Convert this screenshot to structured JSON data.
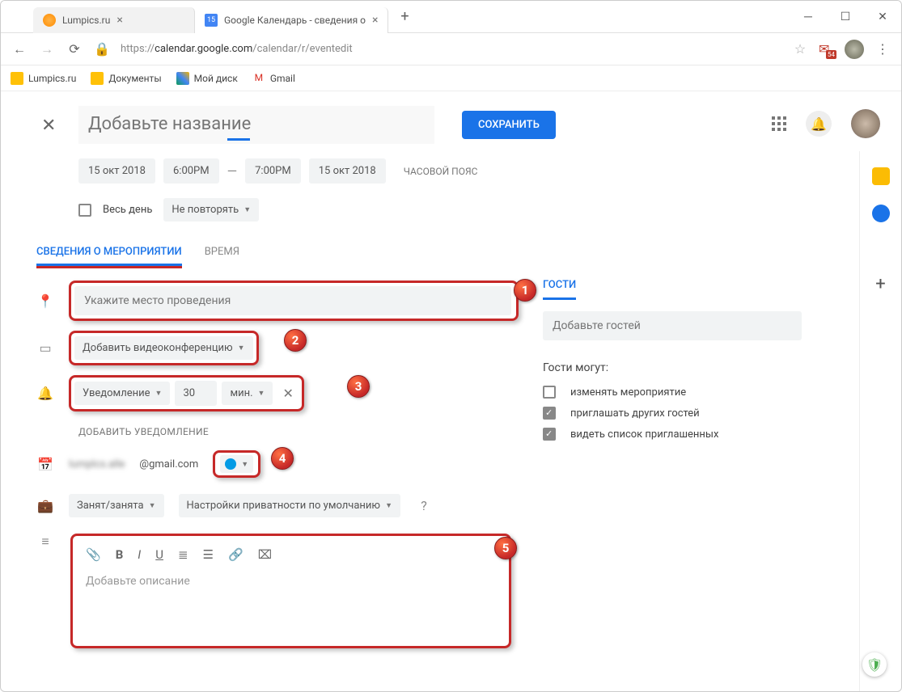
{
  "browser": {
    "tabs": [
      {
        "label": "Lumpics.ru"
      },
      {
        "label": "Google Календарь - сведения о",
        "badge": "15"
      }
    ],
    "url_prefix": "https://",
    "url_host": "calendar.google.com",
    "url_path": "/calendar/r/eventedit",
    "gmail_badge": "54",
    "bookmarks": [
      {
        "label": "Lumpics.ru"
      },
      {
        "label": "Документы"
      },
      {
        "label": "Мой диск"
      },
      {
        "label": "Gmail"
      }
    ]
  },
  "event": {
    "title_placeholder": "Добавьте название",
    "save_label": "СОХРАНИТЬ",
    "date_start": "15 окт 2018",
    "time_start": "6:00PM",
    "time_end": "7:00PM",
    "date_end": "15 окт 2018",
    "timezone_label": "ЧАСОВОЙ ПОЯС",
    "all_day_label": "Весь день",
    "repeat_label": "Не повторять",
    "tabs": {
      "details": "СВЕДЕНИЯ О МЕРОПРИЯТИИ",
      "time": "ВРЕМЯ"
    },
    "location_placeholder": "Укажите место проведения",
    "video_label": "Добавить видеоконференцию",
    "notification": {
      "type": "Уведомление",
      "value": "30",
      "unit": "мин."
    },
    "add_notification_label": "ДОБАВИТЬ УВЕДОМЛЕНИЕ",
    "organizer_email_suffix": "@gmail.com",
    "busy_label": "Занят/занята",
    "privacy_label": "Настройки приватности по умолчанию",
    "description_placeholder": "Добавьте описание"
  },
  "guests": {
    "tab_label": "ГОСТИ",
    "input_placeholder": "Добавьте гостей",
    "perms_title": "Гости могут:",
    "perm_modify": "изменять мероприятие",
    "perm_invite": "приглашать других гостей",
    "perm_seelist": "видеть список приглашенных"
  },
  "callouts": {
    "c1": "1",
    "c2": "2",
    "c3": "3",
    "c4": "4",
    "c5": "5"
  }
}
